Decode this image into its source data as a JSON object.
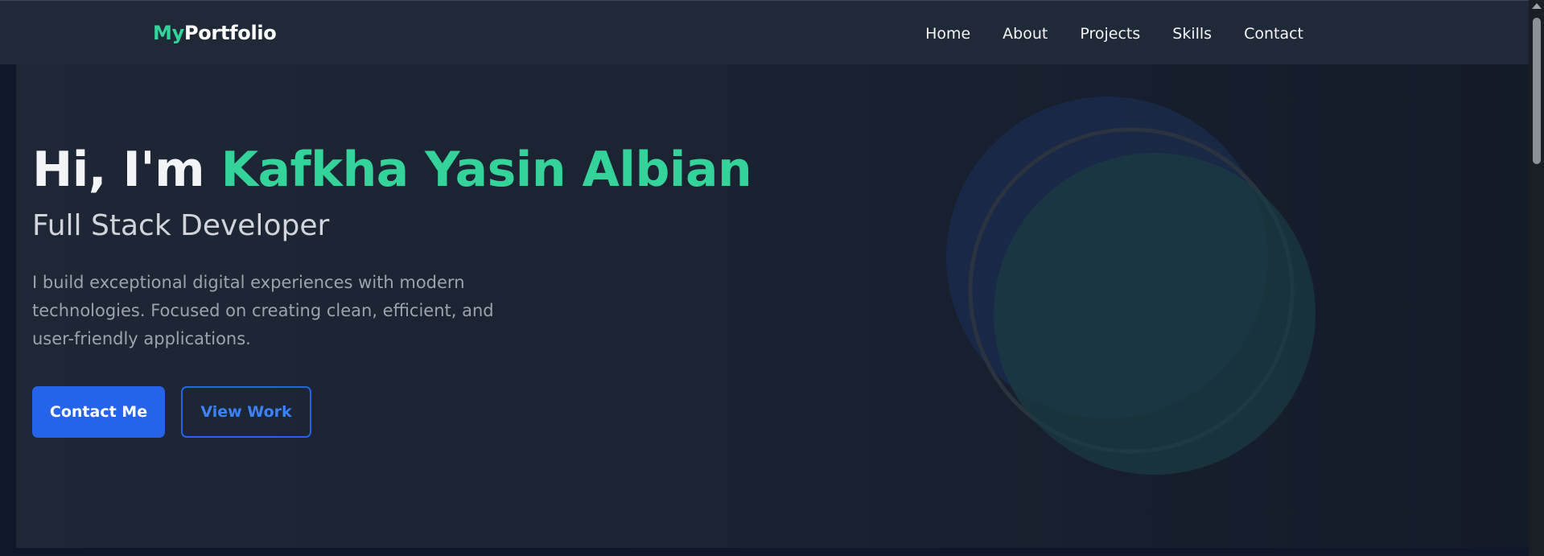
{
  "nav": {
    "brand_accent": "My",
    "brand_rest": "Portfolio",
    "links": [
      "Home",
      "About",
      "Projects",
      "Skills",
      "Contact"
    ]
  },
  "hero": {
    "greeting": "Hi, I'm ",
    "name": "Kafkha Yasin Albian",
    "subtitle": "Full Stack Developer",
    "description": "I build exceptional digital experiences with modern technologies. Focused on creating clean, efficient, and user-friendly applications.",
    "primary_button": "Contact Me",
    "secondary_button": "View Work"
  },
  "colors": {
    "accent_green": "#34d399",
    "primary_blue": "#2563eb",
    "nav_background": "#1f2937",
    "page_background": "#0f172a"
  }
}
